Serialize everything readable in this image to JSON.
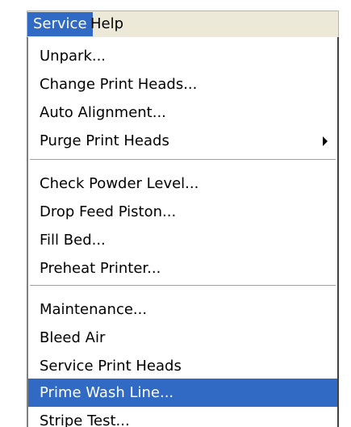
{
  "menubar": {
    "items": [
      {
        "label": "Service",
        "active": true
      },
      {
        "label": "Help",
        "active": false
      }
    ]
  },
  "menu": {
    "groups": [
      {
        "items": [
          {
            "label": "Unpark..."
          },
          {
            "label": "Change Print Heads..."
          },
          {
            "label": "Auto Alignment..."
          },
          {
            "label": "Purge Print Heads",
            "submenu": true
          }
        ]
      },
      {
        "items": [
          {
            "label": "Check Powder Level..."
          },
          {
            "label": "Drop Feed Piston..."
          },
          {
            "label": "Fill Bed..."
          },
          {
            "label": "Preheat Printer..."
          }
        ]
      },
      {
        "items": [
          {
            "label": "Maintenance..."
          },
          {
            "label": "Bleed Air"
          },
          {
            "label": "Service Print Heads"
          },
          {
            "label": "Prime Wash Line...",
            "selected": true
          },
          {
            "label": "Stripe Test..."
          }
        ]
      }
    ]
  },
  "colors": {
    "selection": "#316ac5",
    "menubar_bg": "#ece9d8"
  },
  "icons": {
    "submenu": "triangle-right-icon"
  }
}
